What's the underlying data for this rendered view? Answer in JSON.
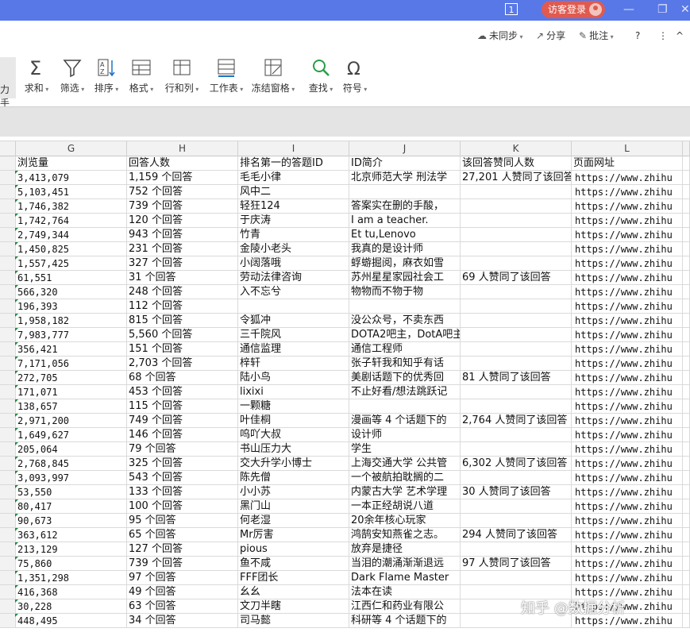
{
  "titlebar": {
    "badge": "1",
    "login_label": "访客登录",
    "bg_color": "#5878e8",
    "login_color": "#e05a4f"
  },
  "toprow": {
    "sync_label": "未同步",
    "share_label": "分享",
    "comment_label": "批注",
    "help_label": "?",
    "more_label": "⋮",
    "collapse_label": "^"
  },
  "ribbon": {
    "left_partial_label": "力手",
    "buttons": [
      {
        "label": "求和",
        "icon": "sigma-icon"
      },
      {
        "label": "筛选",
        "icon": "filter-icon"
      },
      {
        "label": "排序",
        "icon": "sort-icon"
      },
      {
        "label": "格式",
        "icon": "format-icon"
      },
      {
        "label": "行和列",
        "icon": "rows-cols-icon"
      },
      {
        "label": "工作表",
        "icon": "worksheet-icon"
      },
      {
        "label": "冻结窗格",
        "icon": "freeze-icon"
      },
      {
        "label": "查找",
        "icon": "search-icon"
      },
      {
        "label": "符号",
        "icon": "omega-icon"
      }
    ]
  },
  "columns": [
    "G",
    "H",
    "I",
    "J",
    "K",
    "L"
  ],
  "rows": [
    [
      "浏览量",
      "回答人数",
      "排名第一的答题ID",
      "ID简介",
      "该回答赞同人数",
      "页面网址"
    ],
    [
      "3,413,079",
      "1,159 个回答",
      "毛毛小律",
      "北京师范大学 刑法学",
      "27,201 人赞同了该回答",
      "https://www.zhihu"
    ],
    [
      "5,103,451",
      "752 个回答",
      "风中二",
      "",
      "",
      "https://www.zhihu"
    ],
    [
      "1,746,382",
      "739 个回答",
      "轻狂124",
      "答案实在删的手酸，",
      "",
      "https://www.zhihu"
    ],
    [
      "1,742,764",
      "120 个回答",
      "于庆涛",
      "I am a teacher.",
      "",
      "https://www.zhihu"
    ],
    [
      "2,749,344",
      "943 个回答",
      "竹青",
      "Et tu,Lenovo",
      "",
      "https://www.zhihu"
    ],
    [
      "1,450,825",
      "231 个回答",
      "金陵小老头",
      "我真的是设计师",
      "",
      "https://www.zhihu"
    ],
    [
      "1,557,425",
      "327 个回答",
      "小阔落哦",
      "蜉蝣掘阅，麻衣如雪",
      "",
      "https://www.zhihu"
    ],
    [
      "61,551",
      "31 个回答",
      "劳动法律咨询",
      "苏州星星家园社会工",
      "69 人赞同了该回答",
      "https://www.zhihu"
    ],
    [
      "566,320",
      "248 个回答",
      "入不忘兮",
      "物物而不物于物",
      "",
      "https://www.zhihu"
    ],
    [
      "196,393",
      "112 个回答",
      "",
      "",
      "",
      "https://www.zhihu"
    ],
    [
      "1,958,182",
      "815 个回答",
      "令狐冲",
      "没公众号，不卖东西",
      "",
      "https://www.zhihu"
    ],
    [
      "7,983,777",
      "5,560 个回答",
      "三千院风",
      "DOTA2吧主，DotA吧主",
      "",
      "https://www.zhihu"
    ],
    [
      "356,421",
      "151 个回答",
      "通信监理",
      "通信工程师",
      "",
      "https://www.zhihu"
    ],
    [
      "7,171,056",
      "2,703 个回答",
      "梓轩",
      "张子轩我和知乎有话",
      "",
      "https://www.zhihu"
    ],
    [
      "272,705",
      "68 个回答",
      "陆小鸟",
      "美剧话题下的优秀回",
      "81 人赞同了该回答",
      "https://www.zhihu"
    ],
    [
      "171,071",
      "453 个回答",
      "lixixi",
      "不止好看/想法跳跃记",
      "",
      "https://www.zhihu"
    ],
    [
      "138,657",
      "115 个回答",
      "一颗糖",
      "",
      "",
      "https://www.zhihu"
    ],
    [
      "2,971,200",
      "749 个回答",
      "叶佳桐",
      "漫画等 4 个话题下的",
      "2,764 人赞同了该回答",
      "https://www.zhihu"
    ],
    [
      "1,649,627",
      "146 个回答",
      "呜吖大叔",
      "设计师",
      "",
      "https://www.zhihu"
    ],
    [
      "205,064",
      "79 个回答",
      "书山压力大",
      "学生",
      "",
      "https://www.zhihu"
    ],
    [
      "2,768,845",
      "325 个回答",
      "交大升学小博士",
      "上海交通大学 公共管",
      "6,302 人赞同了该回答",
      "https://www.zhihu"
    ],
    [
      "3,093,997",
      "543 个回答",
      "陈先僧",
      "一个被航拍耽搁的二",
      "",
      "https://www.zhihu"
    ],
    [
      "53,550",
      "133 个回答",
      "小小苏",
      "内蒙古大学 艺术学理",
      "30 人赞同了该回答",
      "https://www.zhihu"
    ],
    [
      "80,417",
      "100 个回答",
      "黑门山",
      "一本正经胡说八道",
      "",
      "https://www.zhihu"
    ],
    [
      "90,673",
      "95 个回答",
      "何老湿",
      "20余年核心玩家",
      "",
      "https://www.zhihu"
    ],
    [
      "363,612",
      "65 个回答",
      "Mr厉害",
      "鸿鹄安知燕雀之志。",
      "294 人赞同了该回答",
      "https://www.zhihu"
    ],
    [
      "213,129",
      "127 个回答",
      "pious",
      "放弃是捷径",
      "",
      "https://www.zhihu"
    ],
    [
      "75,860",
      "739 个回答",
      "鱼不咸",
      "当泪的潮涌渐渐退远",
      "97 人赞同了该回答",
      "https://www.zhihu"
    ],
    [
      "1,351,298",
      "97 个回答",
      "FFF团长",
      "Dark Flame Master",
      "",
      "https://www.zhihu"
    ],
    [
      "416,368",
      "49 个回答",
      "幺幺",
      "法本在读",
      "",
      "https://www.zhihu"
    ],
    [
      "30,228",
      "63 个回答",
      "文刀半瞎",
      "江西仁和药业有限公",
      "",
      "https://www.zhihu"
    ],
    [
      "448,495",
      "34 个回答",
      "司马懿",
      "科研等 4 个话题下的",
      "",
      "https://www.zhihu"
    ]
  ],
  "watermark": "知乎 @数据分析"
}
